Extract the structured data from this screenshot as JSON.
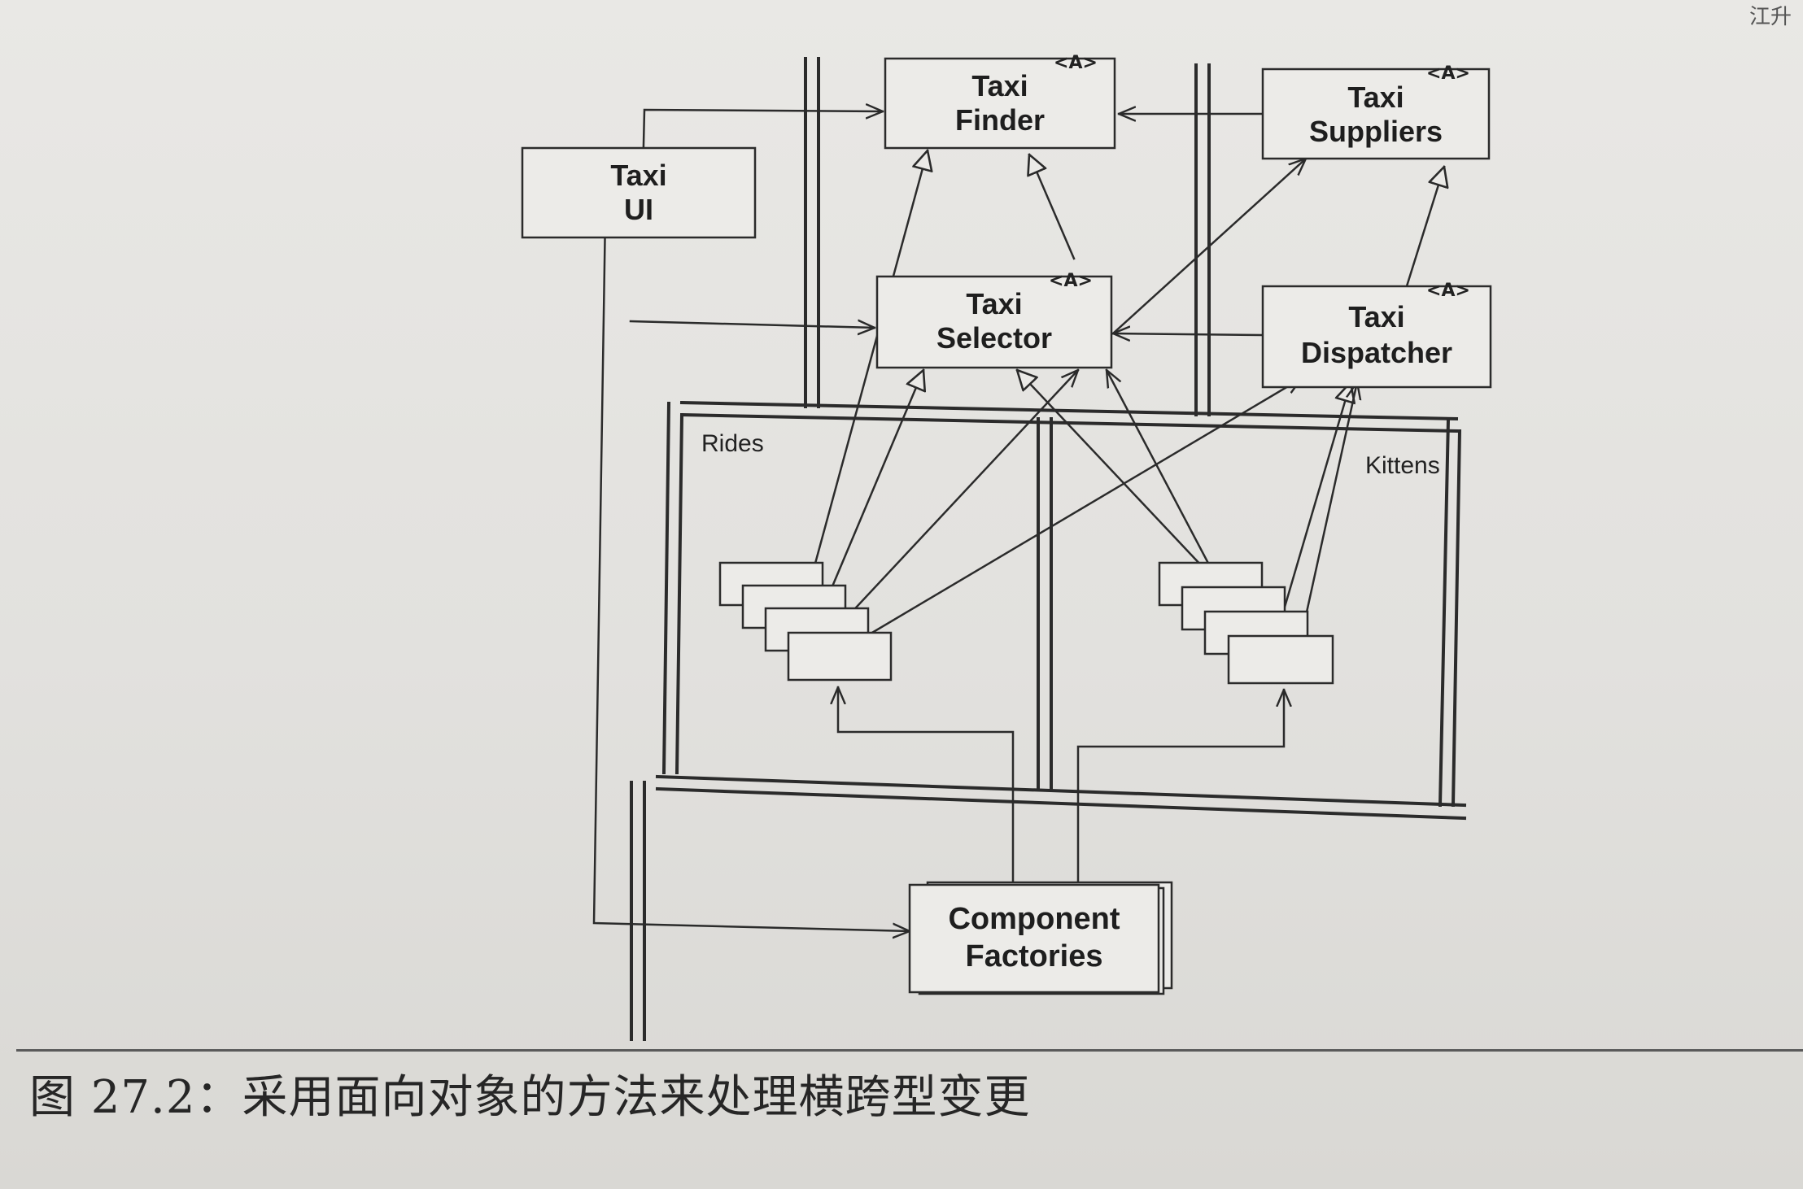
{
  "diagram": {
    "boxes": {
      "taxi_ui": [
        "Taxi",
        "UI"
      ],
      "taxi_finder": [
        "Taxi",
        "Finder"
      ],
      "taxi_suppliers": [
        "Taxi",
        "Suppliers"
      ],
      "taxi_selector": [
        "Taxi",
        "Selector"
      ],
      "taxi_dispatcher": [
        "Taxi",
        "Dispatcher"
      ],
      "component_factories": [
        "Component",
        "Factories"
      ]
    },
    "abstract_marker": "<A>",
    "packages": {
      "rides": "Rides",
      "kittens": "Kittens"
    }
  },
  "caption": "图 27.2：采用面向对象的方法来处理横跨型变更",
  "corner_text": "江升"
}
